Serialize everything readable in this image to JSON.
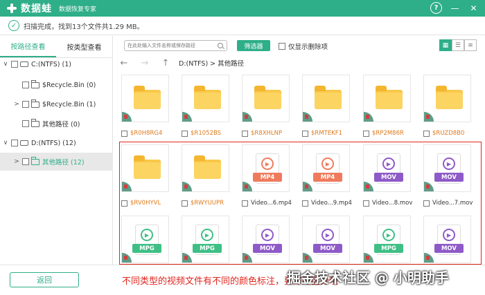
{
  "app": {
    "name": "数据蛙",
    "subtitle": "数据恢复专家",
    "help_label": "?",
    "minimize_label": "—",
    "close_label": "✕"
  },
  "status": {
    "text": "扫描完成，找到13个文件共1.29 MB。",
    "check": "✓"
  },
  "sidebar": {
    "tabs": [
      {
        "label": "按路径查看",
        "active": true
      },
      {
        "label": "按类型查看",
        "active": false
      }
    ],
    "tree": [
      {
        "label": "C:(NTFS) (1)",
        "caret": "∨",
        "kind": "drive"
      },
      {
        "label": "$Recycle.Bin (0)",
        "caret": "",
        "kind": "folder"
      },
      {
        "label": "$Recycle.Bin (1)",
        "caret": ">",
        "kind": "folder"
      },
      {
        "label": "其他路径 (0)",
        "caret": "",
        "kind": "folder"
      },
      {
        "label": "D:(NTFS) (12)",
        "caret": "∨",
        "kind": "drive"
      },
      {
        "label": "其他路径 (12)",
        "caret": ">",
        "kind": "folder",
        "selected": true
      }
    ]
  },
  "toolbar": {
    "search_placeholder": "在此处输入文件名称或保存路径",
    "filter_label": "筛选器",
    "only_deleted_label": "仅显示删除项"
  },
  "pathbar": {
    "back": "←",
    "forward": "→",
    "up": "↑",
    "path": "D:(NTFS)  >  其他路径"
  },
  "files": [
    {
      "name": "$R0H8RG4",
      "type": "folder"
    },
    {
      "name": "$R1052BS",
      "type": "folder"
    },
    {
      "name": "$R8XHLNP",
      "type": "folder"
    },
    {
      "name": "$RMTEKF1",
      "type": "folder"
    },
    {
      "name": "$RP2M86R",
      "type": "folder"
    },
    {
      "name": "$RUZD8B0",
      "type": "folder"
    },
    {
      "name": "$RV0HYVL",
      "type": "folder"
    },
    {
      "name": "$RWYUUPR",
      "type": "folder"
    },
    {
      "name": "Video...6.mp4",
      "type": "video",
      "ext": "MP4"
    },
    {
      "name": "Video...9.mp4",
      "type": "video",
      "ext": "MP4"
    },
    {
      "name": "Video...8.mov",
      "type": "video",
      "ext": "MOV"
    },
    {
      "name": "Video...7.mov",
      "type": "video",
      "ext": "MOV"
    },
    {
      "name": "",
      "type": "video",
      "ext": "MPG"
    },
    {
      "name": "",
      "type": "video",
      "ext": "MPG"
    },
    {
      "name": "",
      "type": "video",
      "ext": "MOV"
    },
    {
      "name": "",
      "type": "video",
      "ext": "MOV"
    },
    {
      "name": "",
      "type": "video",
      "ext": "MPG"
    },
    {
      "name": "",
      "type": "video",
      "ext": "MOV"
    }
  ],
  "ext_colors": {
    "MP4": "#ef7b5c",
    "MOV": "#8e5ac8",
    "MPG": "#3fbf86"
  },
  "footer": {
    "back_label": "返回",
    "annotation": "不同类型的视频文件有不同的颜色标注，要好好区分哦",
    "watermark": "掘金技术社区 @ 小明助手"
  }
}
